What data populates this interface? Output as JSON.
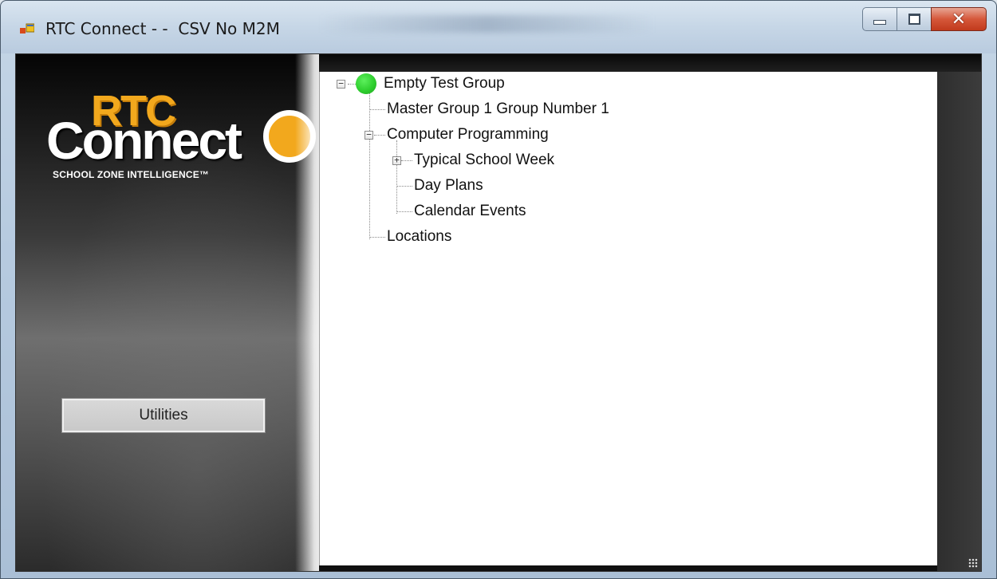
{
  "window": {
    "title": "RTC Connect - -  CSV No M2M",
    "icons": {
      "app": "app-window-icon",
      "minimize": "minimize-icon",
      "maximize": "maximize-icon",
      "close": "close-icon"
    }
  },
  "logo": {
    "rtc": "RTC",
    "connect": "Connect",
    "tagline": "SCHOOL ZONE INTELLIGENCE™",
    "colors": {
      "accent": "#f2a81d",
      "text": "#ffffff"
    }
  },
  "sidebar": {
    "utilities_label": "Utilities"
  },
  "tree": {
    "status_color": "#2fcf2f",
    "nodes": [
      {
        "label": "Empty Test Group",
        "expanded": true,
        "status": "green"
      },
      {
        "label": "Master Group 1 Group Number 1"
      },
      {
        "label": "Computer Programming",
        "expanded": true
      },
      {
        "label": "Typical School Week",
        "expanded": false
      },
      {
        "label": "Day Plans"
      },
      {
        "label": "Calendar Events"
      },
      {
        "label": "Locations"
      }
    ]
  }
}
